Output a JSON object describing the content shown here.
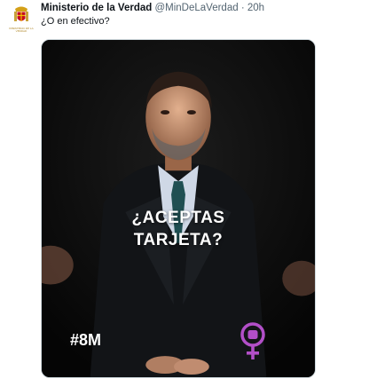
{
  "tweet": {
    "author_name": "Ministerio de la Verdad",
    "handle": "@MinDeLaVerdad",
    "separator": "·",
    "time": "20h",
    "text": "¿O en efectivo?",
    "avatar_icon": "coat-of-arms-icon",
    "avatar_caption": "MINISTERIO DE LA VERDAD"
  },
  "media": {
    "line1": "¿ACEPTAS",
    "line2": "TARJETA?",
    "hashtag": "#8M",
    "symbol_icon": "feminist-fist-symbol-icon",
    "symbol_color": "#b24fc8"
  }
}
